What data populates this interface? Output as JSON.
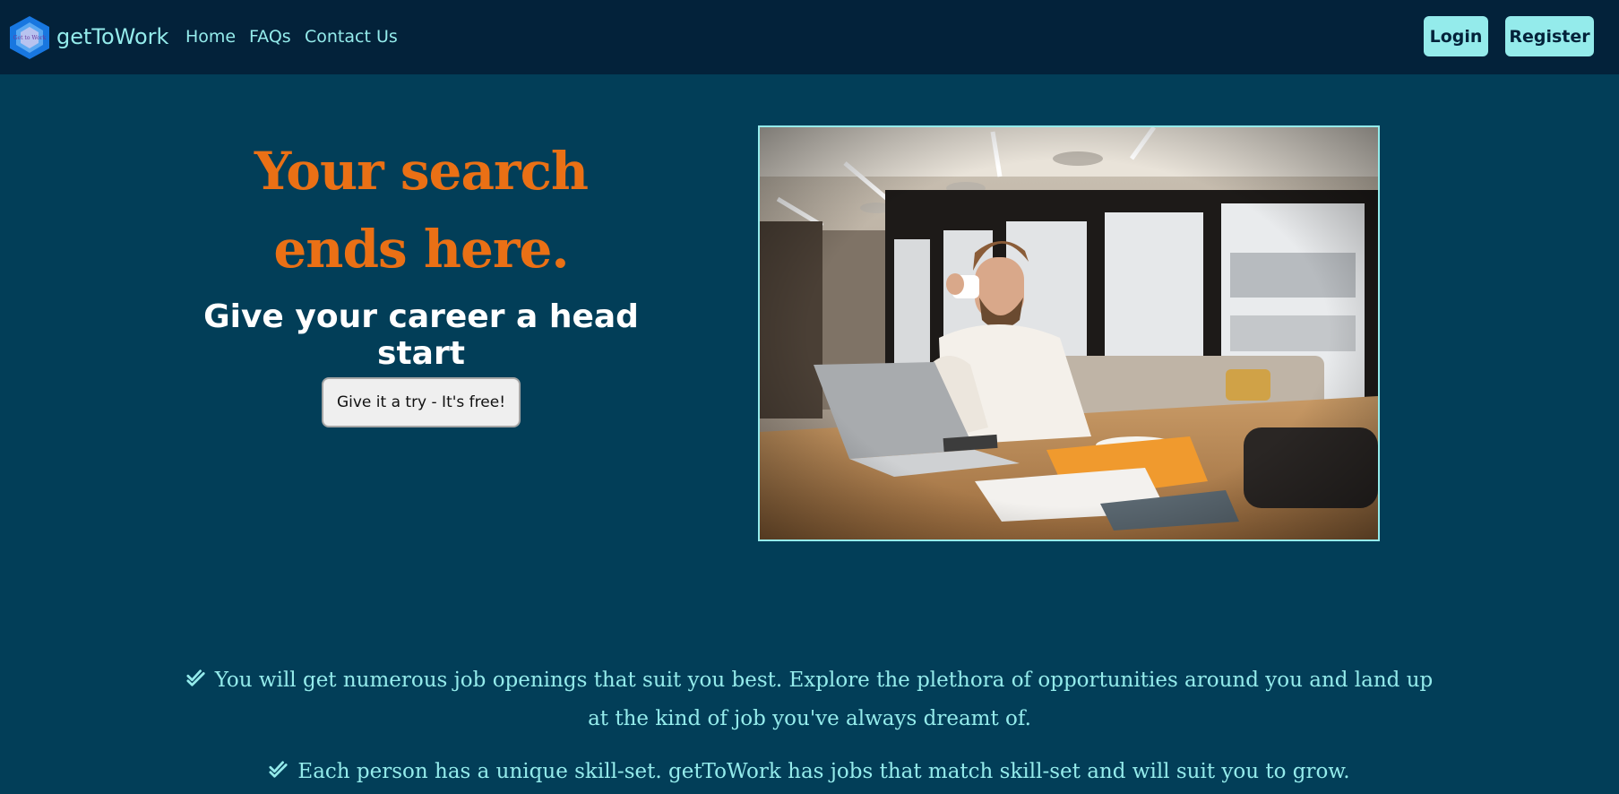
{
  "brand": {
    "name": "getToWork",
    "logo_text": "Get to Work"
  },
  "nav": {
    "home": "Home",
    "faqs": "FAQs",
    "contact": "Contact Us"
  },
  "auth": {
    "login": "Login",
    "register": "Register"
  },
  "hero": {
    "title": "Your search ends here.",
    "subtitle": "Give your career a head start",
    "cta_label": "Give it a try - It's free!"
  },
  "features": [
    {
      "text": "You will get numerous job openings that suit you best. Explore the plethora of opportunities around you and land up at the kind of job you've always dreamt of."
    },
    {
      "text": "Each person has a unique skill-set. getToWork has jobs that match skill-set and will suit you to grow."
    }
  ],
  "colors": {
    "navbar_bg": "#03223a",
    "page_bg": "#023e58",
    "accent": "#94ebeb",
    "title_orange": "#ea7015"
  },
  "icons": {
    "feature_bullet": "double-check-icon"
  }
}
